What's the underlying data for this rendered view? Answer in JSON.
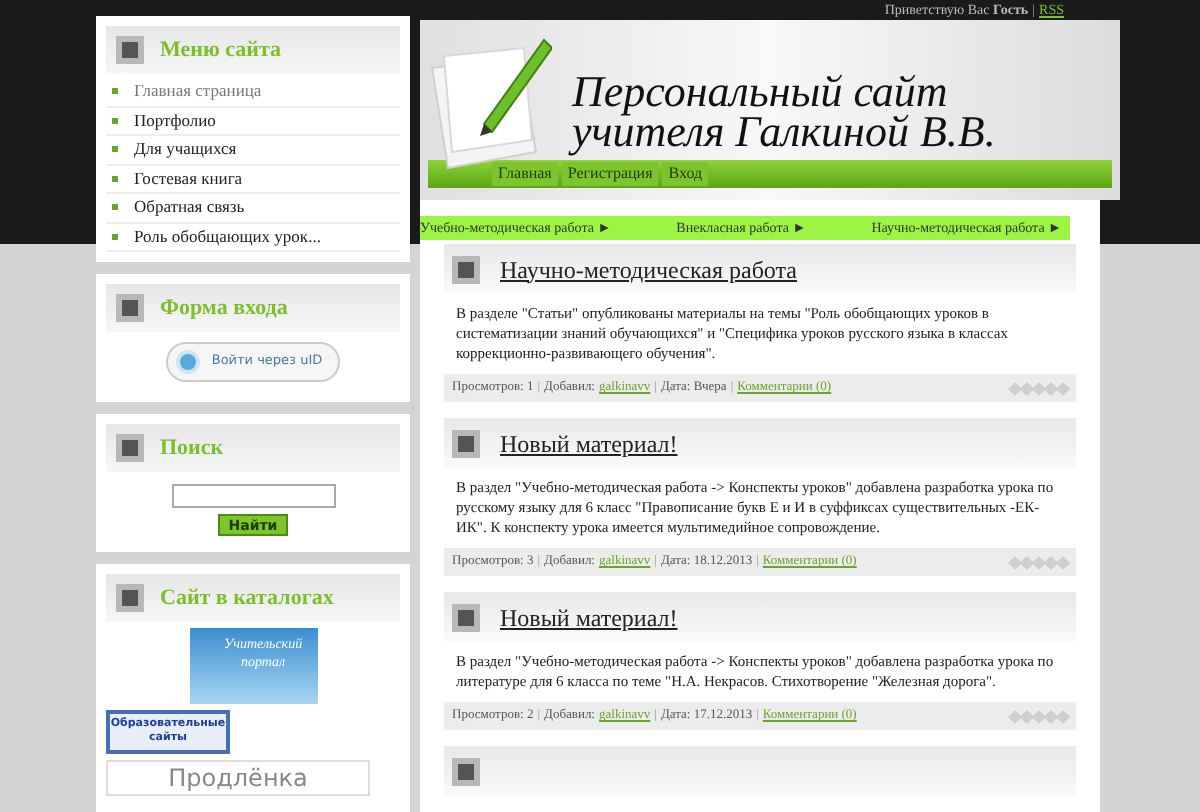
{
  "top_bar": {
    "greeting": "Приветствую Вас",
    "user": "Гость",
    "separator": "|",
    "rss": "RSS"
  },
  "sidebar": {
    "menu": {
      "title": "Меню сайта",
      "items": [
        {
          "label": "Главная страница",
          "selected": true
        },
        {
          "label": "Портфолио",
          "selected": false
        },
        {
          "label": "Для учащихся",
          "selected": false
        },
        {
          "label": "Гостевая книга",
          "selected": false
        },
        {
          "label": "Обратная связь",
          "selected": false
        },
        {
          "label": "Роль обобщающих урок...",
          "selected": false
        }
      ]
    },
    "login": {
      "title": "Форма входа",
      "button": "Войти через uID"
    },
    "search": {
      "title": "Поиск",
      "button": "Найти"
    },
    "catalogs": {
      "title": "Сайт в каталогах",
      "banners": [
        {
          "kind": "globe",
          "text": "Учительский портал"
        },
        {
          "kind": "box",
          "text": "Образовательные сайты"
        },
        {
          "kind": "wide",
          "text": "Продлёнка"
        }
      ]
    }
  },
  "header": {
    "title_lines": [
      "Персональный сайт",
      "учителя Галкиной В.В."
    ],
    "nav": [
      "Главная",
      "Регистрация",
      "Вход"
    ]
  },
  "subnav": [
    {
      "label": "Учебно-методическая работа",
      "arrow": "►"
    },
    {
      "label": "Внекласная работа",
      "arrow": "►"
    },
    {
      "label": "Научно-методическая работа",
      "arrow": "►"
    }
  ],
  "posts": [
    {
      "title": "Научно-методическая работа",
      "body": "В разделе \"Статьи\" опубликованы материалы на темы \"Роль обобщающих уроков в систематизации знаний обучающихся\" и \"Специфика уроков русского языка в классах коррекционно-развивающего обучения\".",
      "meta": [
        {
          "kind": "text",
          "text": "Просмотров: 1"
        },
        {
          "kind": "sep",
          "text": "|"
        },
        {
          "kind": "text",
          "text": "Добавил:"
        },
        {
          "kind": "link",
          "text": "galkinavv"
        },
        {
          "kind": "sep",
          "text": "|"
        },
        {
          "kind": "text",
          "text": "Дата: Вчера"
        },
        {
          "kind": "sep",
          "text": "|"
        },
        {
          "kind": "link",
          "text": "Комментарии (0)"
        }
      ],
      "stars": 0
    },
    {
      "title": "Новый материал!",
      "body": "В раздел \"Учебно-методическая работа -> Конспекты уроков\" добавлена разработка урока по русскому языку для 6 класс \"Правописание букв Е и И в суффиксах существительных -ЕК-ИК\". К конспекту урока имеется мультимедийное сопровождение.",
      "meta": [
        {
          "kind": "text",
          "text": "Просмотров: 3"
        },
        {
          "kind": "sep",
          "text": "|"
        },
        {
          "kind": "text",
          "text": "Добавил:"
        },
        {
          "kind": "link",
          "text": "galkinavv"
        },
        {
          "kind": "sep",
          "text": "|"
        },
        {
          "kind": "text",
          "text": "Дата: 18.12.2013"
        },
        {
          "kind": "sep",
          "text": "|"
        },
        {
          "kind": "link",
          "text": "Комментарии (0)"
        }
      ],
      "stars": 0
    },
    {
      "title": "Новый материал!",
      "body": "В раздел \"Учебно-методическая работа -> Конспекты уроков\" добавлена разработка урока по литературе для 6 класса по теме \"Н.А. Некрасов. Стихотворение \"Железная дорога\".",
      "meta": [
        {
          "kind": "text",
          "text": "Просмотров: 2"
        },
        {
          "kind": "sep",
          "text": "|"
        },
        {
          "kind": "text",
          "text": "Добавил:"
        },
        {
          "kind": "link",
          "text": "galkinavv"
        },
        {
          "kind": "sep",
          "text": "|"
        },
        {
          "kind": "text",
          "text": "Дата: 17.12.2013"
        },
        {
          "kind": "sep",
          "text": "|"
        },
        {
          "kind": "link",
          "text": "Комментарии (0)"
        }
      ],
      "stars": 0
    }
  ]
}
